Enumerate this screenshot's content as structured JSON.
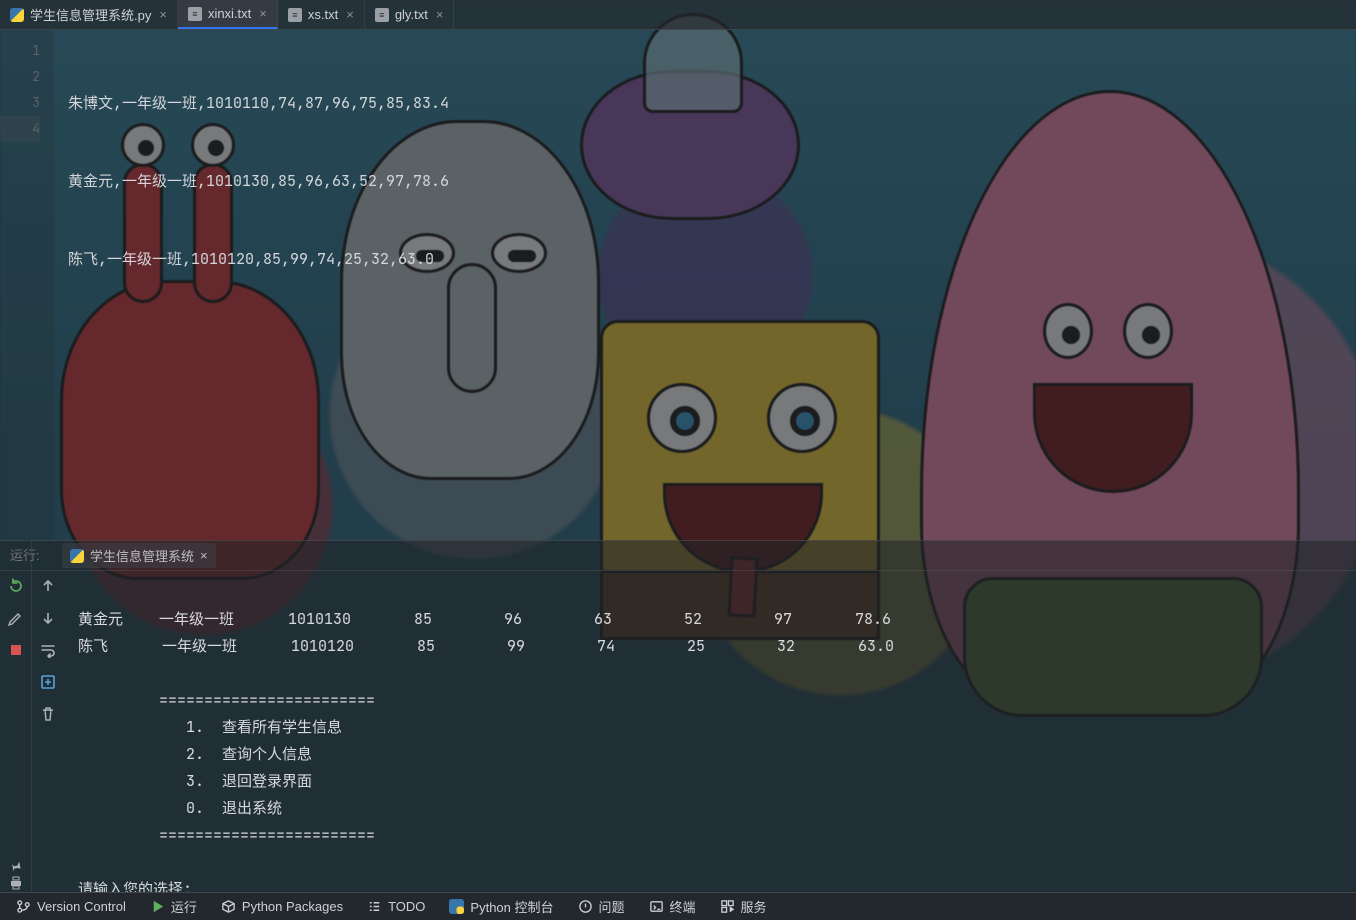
{
  "tabs": [
    {
      "label": "学生信息管理系统.py"
    },
    {
      "label": "xinxi.txt"
    },
    {
      "label": "xs.txt"
    },
    {
      "label": "gly.txt"
    }
  ],
  "editor": {
    "line_numbers": [
      "1",
      "2",
      "3",
      "4"
    ],
    "lines": [
      "朱博文,一年级一班,1010110,74,87,96,75,85,83.4",
      "黄金元,一年级一班,1010130,85,96,63,52,97,78.6",
      "陈飞,一年级一班,1010120,85,99,74,25,32,63.0",
      ""
    ]
  },
  "run": {
    "title": "运行:",
    "config_name": "学生信息管理系统",
    "output": [
      "黄金元    一年级一班      1010130       85        96        63        52        97       78.6",
      "陈飞      一年级一班      1010120       85        99        74        25        32       63.0",
      "",
      "         ========================",
      "            1.  查看所有学生信息",
      "            2.  查询个人信息",
      "            3.  退回登录界面",
      "            0.  退出系统",
      "         ========================",
      "",
      "请输入您的选择:"
    ]
  },
  "status": {
    "items": [
      "Version Control",
      "运行",
      "Python Packages",
      "TODO",
      "Python 控制台",
      "问题",
      "终端",
      "服务"
    ]
  }
}
